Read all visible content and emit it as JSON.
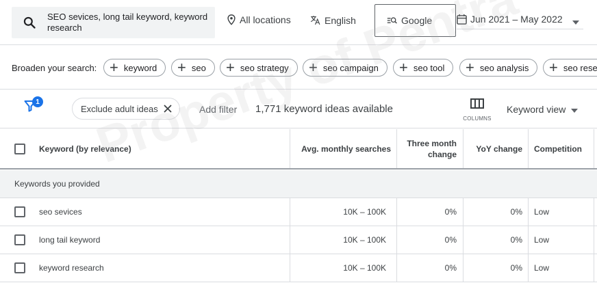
{
  "search": {
    "query": "SEO sevices, long tail keyword, keyword research"
  },
  "location": {
    "label": "All locations"
  },
  "language": {
    "label": "English"
  },
  "network": {
    "label": "Google"
  },
  "date_range": {
    "label": "Jun 2021 – May 2022"
  },
  "broaden": {
    "label": "Broaden your search:",
    "chips": [
      "keyword",
      "seo",
      "seo strategy",
      "seo campaign",
      "seo tool",
      "seo analysis",
      "seo rese"
    ]
  },
  "filters": {
    "badge_count": "1",
    "exclude_chip": "Exclude adult ideas",
    "add_filter": "Add filter",
    "ideas_count": "1,771 keyword ideas available",
    "columns_label": "COLUMNS",
    "view_label": "Keyword view"
  },
  "table": {
    "headers": {
      "keyword": "Keyword (by relevance)",
      "searches": "Avg. monthly searches",
      "three_month_line1": "Three month",
      "three_month_line2": "change",
      "yoy": "YoY change",
      "competition": "Competition"
    },
    "group_label": "Keywords you provided",
    "rows": [
      {
        "keyword": "seo sevices",
        "searches": "10K – 100K",
        "three_month": "0%",
        "yoy": "0%",
        "competition": "Low"
      },
      {
        "keyword": "long tail keyword",
        "searches": "10K – 100K",
        "three_month": "0%",
        "yoy": "0%",
        "competition": "Low"
      },
      {
        "keyword": "keyword research",
        "searches": "10K – 100K",
        "three_month": "0%",
        "yoy": "0%",
        "competition": "Low"
      }
    ]
  },
  "watermark": "Property of Pentra",
  "colors": {
    "accent": "#1a73e8",
    "group_bg": "#f1f3f4",
    "divider": "#dadce0"
  }
}
